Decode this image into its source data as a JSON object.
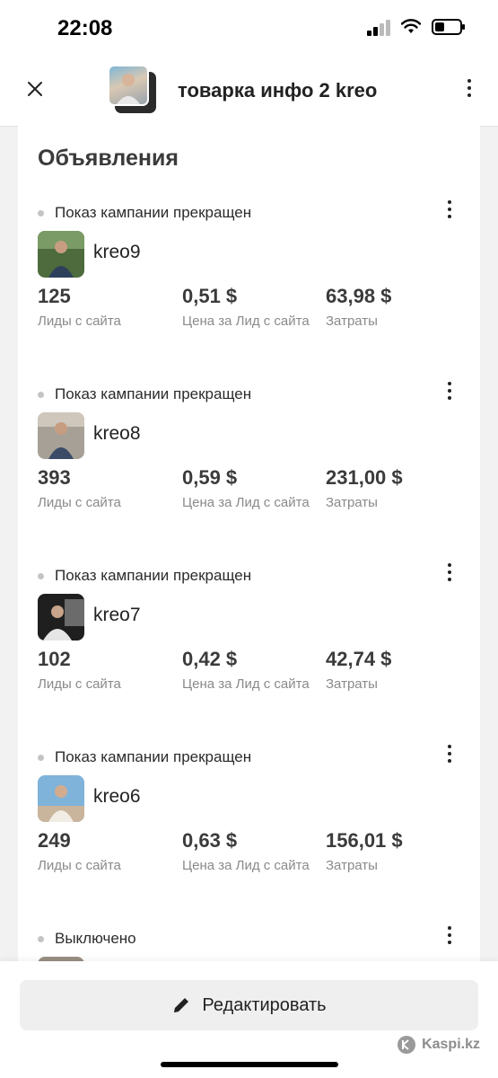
{
  "status_bar": {
    "time": "22:08"
  },
  "header": {
    "title": "товарка инфо 2 kreo",
    "close_icon": "close-icon",
    "menu_icon": "more-vertical-icon"
  },
  "section": {
    "title": "Объявления"
  },
  "metric_labels": {
    "leads": "Лиды с сайта",
    "cpl": "Цена за Лид с сайта",
    "spend": "Затраты"
  },
  "ads": [
    {
      "status": "Показ кампании прекращен",
      "name": "kreo9",
      "leads": "125",
      "cpl": "0,51 $",
      "spend": "63,98 $"
    },
    {
      "status": "Показ кампании прекращен",
      "name": "kreo8",
      "leads": "393",
      "cpl": "0,59 $",
      "spend": "231,00 $"
    },
    {
      "status": "Показ кампании прекращен",
      "name": "kreo7",
      "leads": "102",
      "cpl": "0,42 $",
      "spend": "42,74 $"
    },
    {
      "status": "Показ кампании прекращен",
      "name": "kreo6",
      "leads": "249",
      "cpl": "0,63 $",
      "spend": "156,01 $"
    },
    {
      "status": "Выключено"
    }
  ],
  "bottom": {
    "edit_label": "Редактировать",
    "edit_icon": "pencil-icon",
    "watermark": "Kaspi.kz"
  },
  "colors": {
    "card_bg": "#ffffff",
    "page_bg": "#f2f2f2",
    "button_bg": "#efefef",
    "muted_text": "#8a8a8a"
  }
}
